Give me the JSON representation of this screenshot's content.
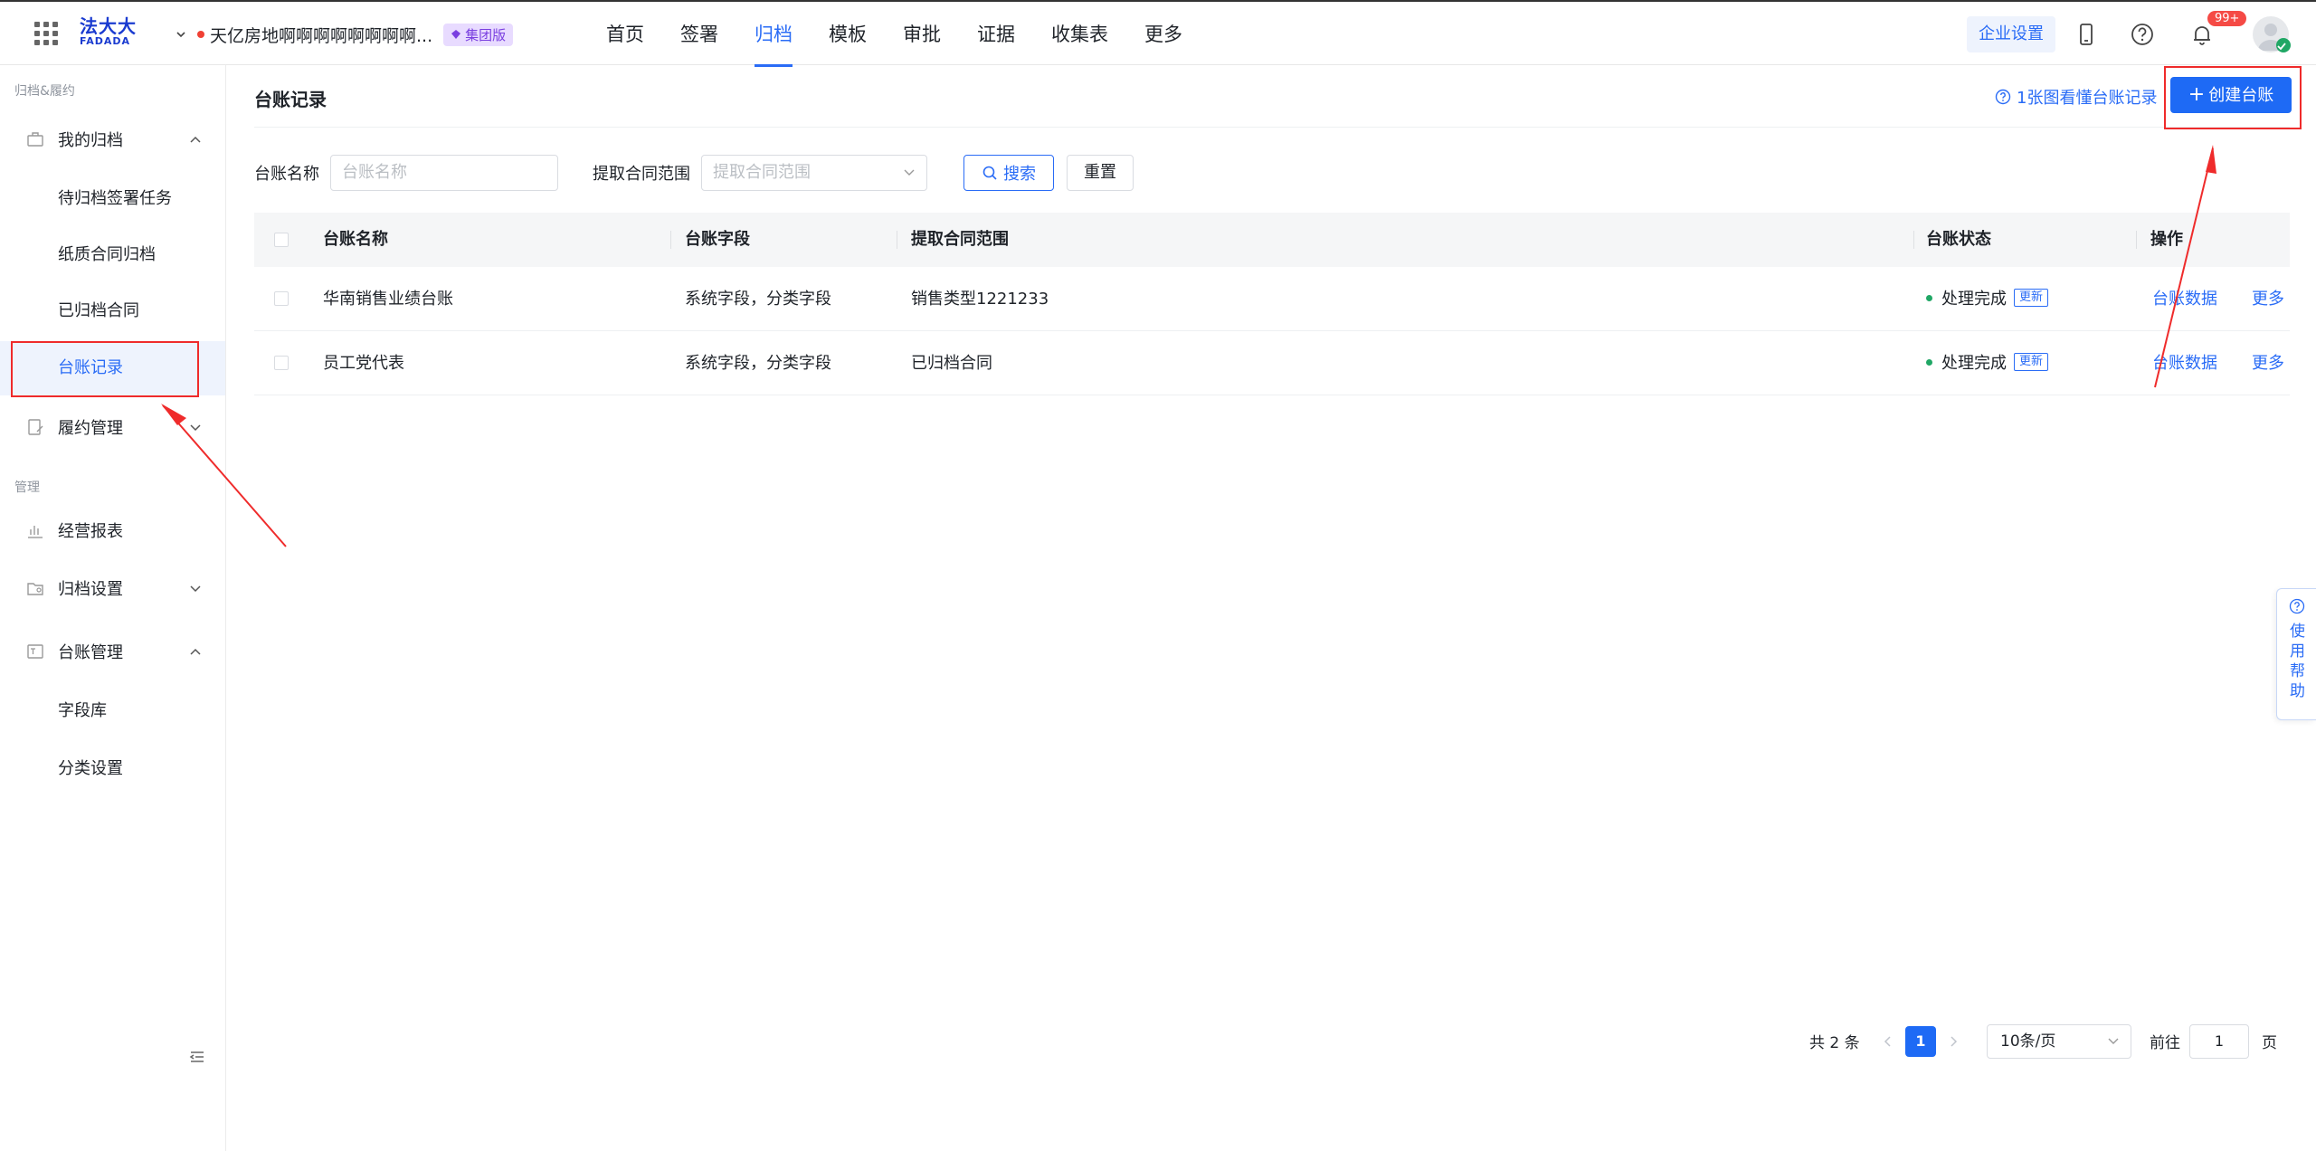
{
  "topbar": {
    "logo_cn": "法大大",
    "logo_en": "FADADA",
    "org_name": "天亿房地啊啊啊啊啊啊啊啊...",
    "org_badge": "集团版",
    "nav": [
      "首页",
      "签署",
      "归档",
      "模板",
      "审批",
      "证据",
      "收集表",
      "更多"
    ],
    "active_nav": "归档",
    "enterprise_settings": "企业设置",
    "notification_count": "99+",
    "icons": [
      "apps-grid-icon",
      "mobile-icon",
      "help-circle-icon",
      "bell-icon",
      "avatar"
    ]
  },
  "sidebar": {
    "section1": "归档&履约",
    "my_archive": "我的归档",
    "my_archive_items": [
      "待归档签署任务",
      "纸质合同归档",
      "已归档合同",
      "台账记录"
    ],
    "active_item": "台账记录",
    "performance": "履约管理",
    "section2": "管理",
    "reports": "经营报表",
    "archive_settings": "归档设置",
    "ledger_mgmt": "台账管理",
    "ledger_items": [
      "字段库",
      "分类设置"
    ]
  },
  "main": {
    "title": "台账记录",
    "help_link": "1张图看懂台账记录",
    "create_button": "创建台账",
    "filters": {
      "name_label": "台账名称",
      "name_placeholder": "台账名称",
      "range_label": "提取合同范围",
      "range_placeholder": "提取合同范围",
      "search_button": "搜索",
      "reset_button": "重置"
    },
    "table": {
      "headers": [
        "台账名称",
        "台账字段",
        "提取合同范围",
        "台账状态",
        "操作"
      ],
      "rows": [
        {
          "name": "华南销售业绩台账",
          "fields": "系统字段，分类字段",
          "range": "销售类型1221233",
          "status": "处理完成",
          "status_tag": "更新",
          "action1": "台账数据",
          "action2": "更多"
        },
        {
          "name": "员工党代表",
          "fields": "系统字段，分类字段",
          "range": "已归档合同",
          "status": "处理完成",
          "status_tag": "更新",
          "action1": "台账数据",
          "action2": "更多"
        }
      ]
    },
    "pagination": {
      "total": "共 2 条",
      "current_page": "1",
      "page_size": "10条/页",
      "goto_label": "前往",
      "goto_value": "1",
      "page_unit": "页"
    }
  },
  "help_float": "使用帮助",
  "colors": {
    "accent": "#2a6cf6",
    "annotation": "#ef2b2b",
    "success": "#20a765"
  }
}
